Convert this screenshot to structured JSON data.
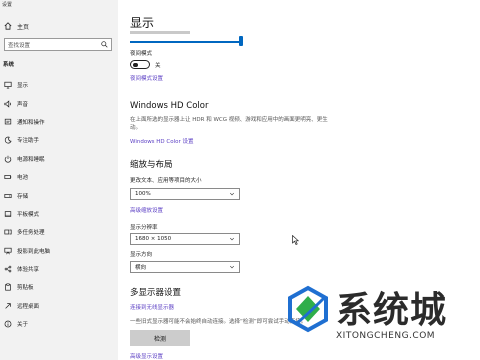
{
  "window": {
    "title": "设置"
  },
  "sidebar": {
    "home_label": "主页",
    "search_placeholder": "查找设置",
    "section_label": "系统",
    "items": [
      {
        "label": "显示",
        "icon": "monitor-icon"
      },
      {
        "label": "声音",
        "icon": "speaker-icon"
      },
      {
        "label": "通知和操作",
        "icon": "notification-icon"
      },
      {
        "label": "专注助手",
        "icon": "moon-icon"
      },
      {
        "label": "电源和睡眠",
        "icon": "power-icon"
      },
      {
        "label": "电池",
        "icon": "battery-icon"
      },
      {
        "label": "存储",
        "icon": "storage-icon"
      },
      {
        "label": "平板模式",
        "icon": "tablet-icon"
      },
      {
        "label": "多任务处理",
        "icon": "multitask-icon"
      },
      {
        "label": "投影到此电脑",
        "icon": "project-icon"
      },
      {
        "label": "体验共享",
        "icon": "share-icon"
      },
      {
        "label": "剪贴板",
        "icon": "clipboard-icon"
      },
      {
        "label": "远程桌面",
        "icon": "remote-icon"
      },
      {
        "label": "关于",
        "icon": "info-icon"
      }
    ]
  },
  "main": {
    "title": "显示",
    "brightness_level": 1.0,
    "night_light": {
      "label": "夜间模式",
      "state": "关",
      "settings_link": "夜间模式设置"
    },
    "hdr": {
      "heading": "Windows HD Color",
      "description": "在上面所选的显示器上让 HDR 和 WCG 视频、游戏和应用中的画面更明亮、更生动。",
      "link": "Windows HD Color 设置"
    },
    "scale_layout": {
      "heading": "缩放与布局",
      "scale_label": "更改文本、应用等项目的大小",
      "scale_value": "100%",
      "advanced_scale_link": "高级缩放设置",
      "resolution_label": "显示分辨率",
      "resolution_value": "1680 × 1050",
      "orientation_label": "显示方向",
      "orientation_value": "横向"
    },
    "multi_display": {
      "heading": "多显示器设置",
      "wireless_link": "连接到无线显示器",
      "note": "一些旧式显示器可能不会始终自动连接。选择“检测”即可尝试手动连接。",
      "detect_button": "检测",
      "advanced_link": "高级显示设置"
    }
  },
  "watermark": {
    "brand": "系统城",
    "domain": "XITONGCHENG.COM"
  }
}
